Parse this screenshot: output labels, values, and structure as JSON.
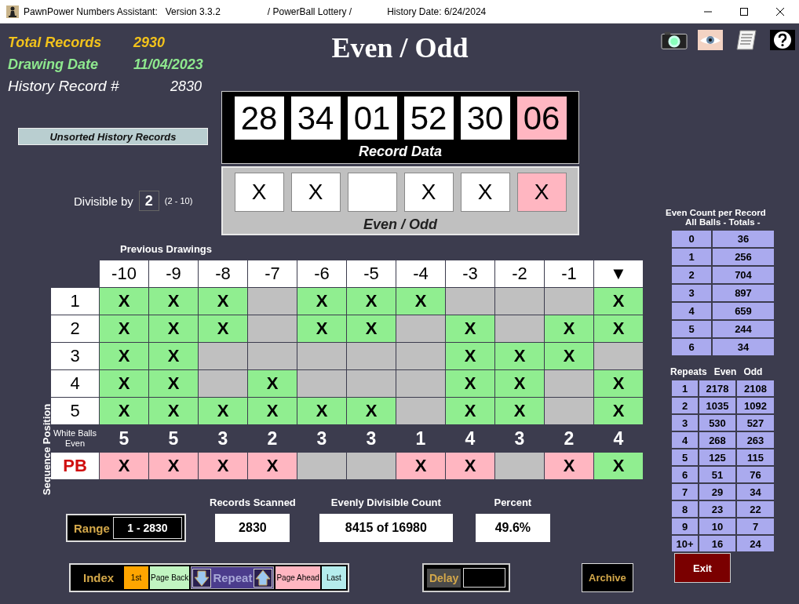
{
  "title_bar": {
    "app": "PawnPower Numbers Assistant:",
    "version": "Version 3.3.2",
    "lottery": "/ PowerBall Lottery /",
    "history_date": "History Date:  6/24/2024"
  },
  "stats": [
    {
      "label": "Total Records",
      "value": "2930",
      "color": "#f2c21b"
    },
    {
      "label": "Drawing Date",
      "value": "11/04/2023",
      "color": "#8ee88e"
    },
    {
      "label": "History Record #",
      "value": "2830",
      "color": "#ffffff"
    }
  ],
  "title": "Even / Odd",
  "sort_button": "Unsorted History Records",
  "divisible": {
    "label": "Divisible by",
    "value": "2",
    "range": "(2 - 10)"
  },
  "record_data": {
    "title": "Record Data",
    "balls": [
      {
        "number": "28",
        "kind": "white"
      },
      {
        "number": "34",
        "kind": "white"
      },
      {
        "number": "01",
        "kind": "white"
      },
      {
        "number": "52",
        "kind": "white"
      },
      {
        "number": "30",
        "kind": "white"
      },
      {
        "number": "06",
        "kind": "powerball"
      }
    ]
  },
  "even_odd": {
    "title": "Even / Odd",
    "cells": [
      {
        "kind": "white",
        "mark": "X"
      },
      {
        "kind": "white",
        "mark": "X"
      },
      {
        "kind": "white"
      },
      {
        "kind": "white",
        "mark": "X"
      },
      {
        "kind": "white",
        "mark": "X"
      },
      {
        "kind": "powerball",
        "mark": "X"
      }
    ]
  },
  "previous_drawings": {
    "title": "Previous Drawings",
    "axis_label": "Sequence Position",
    "columns": [
      "-10",
      "-9",
      "-8",
      "-7",
      "-6",
      "-5",
      "-4",
      "-3",
      "-2",
      "-1",
      "▼"
    ],
    "rows": [
      {
        "label": "1",
        "cells": [
          "X",
          "X",
          "X",
          null,
          "X",
          "X",
          "X",
          null,
          null,
          null,
          "X"
        ]
      },
      {
        "label": "2",
        "cells": [
          "X",
          "X",
          "X",
          null,
          "X",
          "X",
          null,
          "X",
          null,
          "X",
          "X"
        ]
      },
      {
        "label": "3",
        "cells": [
          "X",
          "X",
          null,
          null,
          null,
          null,
          null,
          "X",
          "X",
          "X",
          null
        ]
      },
      {
        "label": "4",
        "cells": [
          "X",
          "X",
          null,
          "X",
          null,
          null,
          null,
          "X",
          "X",
          null,
          "X"
        ]
      },
      {
        "label": "5",
        "cells": [
          "X",
          "X",
          "X",
          "X",
          "X",
          "X",
          null,
          "X",
          "X",
          null,
          "X"
        ]
      }
    ],
    "count_label": "White Balls Even",
    "counts": [
      "5",
      "5",
      "3",
      "2",
      "3",
      "3",
      "1",
      "4",
      "3",
      "2",
      "4"
    ],
    "pb": {
      "label": "PB",
      "cells": [
        {
          "mark": "X",
          "color": "#ffb6c1"
        },
        {
          "mark": "X",
          "color": "#ffb6c1"
        },
        {
          "mark": "X",
          "color": "#ffb6c1"
        },
        {
          "mark": "X",
          "color": "#ffb6c1"
        },
        {
          "color": "#c0c0c0"
        },
        {
          "color": "#c0c0c0"
        },
        {
          "mark": "X",
          "color": "#ffb6c1"
        },
        {
          "mark": "X",
          "color": "#ffb6c1"
        },
        {
          "color": "#c0c0c0"
        },
        {
          "mark": "X",
          "color": "#ffb6c1"
        },
        {
          "mark": "X",
          "color": "#90ee90"
        }
      ]
    }
  },
  "range": {
    "label": "Range",
    "value": "1 - 2830"
  },
  "result_boxes": [
    {
      "label": "Records Scanned",
      "value": "2830"
    },
    {
      "label": "Evenly Divisible Count",
      "value": "8415 of 16980"
    },
    {
      "label": "Percent",
      "value": "49.6%"
    }
  ],
  "navigation": {
    "label": "Index",
    "buttons": [
      {
        "label": "1st",
        "kind": "first"
      },
      {
        "label": "Page Back",
        "kind": "back"
      },
      {
        "label": "Repeat",
        "kind": "repeat"
      },
      {
        "label": "Page Ahead",
        "kind": "ahead"
      },
      {
        "label": "Last",
        "kind": "last"
      }
    ]
  },
  "delay": {
    "label": "Delay"
  },
  "archive_button": "Archive",
  "exit_button": "Exit",
  "even_count": {
    "title": "Even Count per Record",
    "subtitle": "All Balls  - Totals -",
    "rows": [
      [
        "0",
        "36"
      ],
      [
        "1",
        "256"
      ],
      [
        "2",
        "704"
      ],
      [
        "3",
        "897"
      ],
      [
        "4",
        "659"
      ],
      [
        "5",
        "244"
      ],
      [
        "6",
        "34"
      ]
    ]
  },
  "repeats": {
    "columns": [
      "Repeats",
      "Even",
      "Odd"
    ],
    "rows": [
      [
        "1",
        "2178",
        "2108"
      ],
      [
        "2",
        "1035",
        "1092"
      ],
      [
        "3",
        "530",
        "527"
      ],
      [
        "4",
        "268",
        "263"
      ],
      [
        "5",
        "125",
        "115"
      ],
      [
        "6",
        "51",
        "76"
      ],
      [
        "7",
        "29",
        "34"
      ],
      [
        "8",
        "23",
        "22"
      ],
      [
        "9",
        "10",
        "7"
      ],
      [
        "10+",
        "16",
        "24"
      ]
    ]
  }
}
